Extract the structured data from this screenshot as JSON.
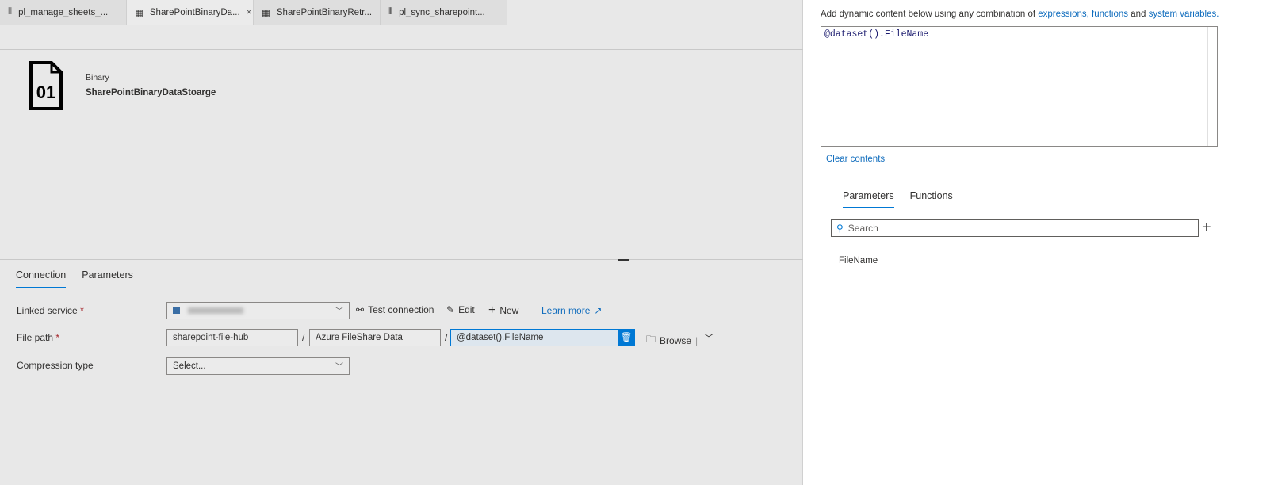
{
  "tabs": [
    {
      "label": "pl_manage_sheets_...",
      "icon": "pipeline-icon"
    },
    {
      "label": "SharePointBinaryDa...",
      "icon": "dataset-icon",
      "active": true,
      "close": "×"
    },
    {
      "label": "SharePointBinaryRetr...",
      "icon": "dataset-icon"
    },
    {
      "label": "pl_sync_sharepoint...",
      "icon": "pipeline-icon"
    }
  ],
  "header": {
    "icon_text": "01",
    "type": "Binary",
    "name": "SharePointBinaryDataStoarge"
  },
  "bottom_tabs": [
    "Connection",
    "Parameters"
  ],
  "form": {
    "linked_service_label": "Linked service",
    "required": "*",
    "test_connection": "Test connection",
    "edit": "Edit",
    "new": "New",
    "learn_more": "Learn more",
    "file_path_label": "File path",
    "path": [
      "sharepoint-file-hub",
      "Azure FileShare Data",
      "@dataset().FileName"
    ],
    "sep": "/",
    "browse": "Browse",
    "compression_label": "Compression type",
    "compression_value": "Select..."
  },
  "panel": {
    "desc_prefix": "Add dynamic content below using any combination of ",
    "link1": "expressions, functions",
    "and": " and ",
    "link2": "system variables.",
    "expression": "@dataset().FileName",
    "clear": "Clear contents",
    "tabs": [
      "Parameters",
      "Functions"
    ],
    "search_placeholder": "Search",
    "params": [
      "FileName"
    ]
  },
  "colors": {
    "accent": "#0078d4",
    "link": "#0f6cbd"
  }
}
